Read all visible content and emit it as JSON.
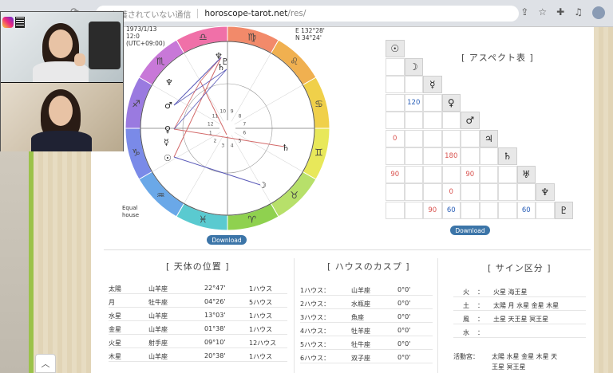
{
  "browser": {
    "warn_icon": "warning-icon",
    "warn_text": "保護されていない通信",
    "url_host": "horoscope-tarot.net",
    "url_path": "/res/"
  },
  "chart": {
    "date": "1973/1/13",
    "time": "12:0",
    "tz": "(UTC+09:00)",
    "lon": "E 132°28'",
    "lat": "N 34°24'",
    "house_system_1": "Equal",
    "house_system_2": "house",
    "download_label": "Download",
    "house_numbers": [
      "1",
      "2",
      "3",
      "4",
      "5",
      "6",
      "7",
      "8",
      "9",
      "10",
      "11",
      "12"
    ]
  },
  "aspect": {
    "title": "[ アスペクト表 ]",
    "download_label": "Download",
    "planets": [
      "☉",
      "☽",
      "☿",
      "♀",
      "♂",
      "♃",
      "♄",
      "♅",
      "♆",
      "♇"
    ],
    "values": [
      {
        "row": 3,
        "col": 1,
        "text": "120",
        "color": "blue"
      },
      {
        "row": 5,
        "col": 0,
        "text": "0",
        "color": "red"
      },
      {
        "row": 6,
        "col": 3,
        "text": "180",
        "color": "red"
      },
      {
        "row": 7,
        "col": 0,
        "text": "90",
        "color": "red"
      },
      {
        "row": 7,
        "col": 4,
        "text": "90",
        "color": "red"
      },
      {
        "row": 8,
        "col": 3,
        "text": "0",
        "color": "red"
      },
      {
        "row": 9,
        "col": 2,
        "text": "90",
        "color": "red"
      },
      {
        "row": 9,
        "col": 3,
        "text": "60",
        "color": "blue"
      },
      {
        "row": 9,
        "col": 7,
        "text": "60",
        "color": "blue"
      }
    ]
  },
  "planets_table": {
    "title": "[ 天体の位置 ]",
    "rows": [
      {
        "planet": "太陽",
        "sign": "山羊座",
        "deg": "22°47'",
        "house": "1ハウス"
      },
      {
        "planet": "月",
        "sign": "牡牛座",
        "deg": "04°26'",
        "house": "5ハウス"
      },
      {
        "planet": "水星",
        "sign": "山羊座",
        "deg": "13°03'",
        "house": "1ハウス"
      },
      {
        "planet": "金星",
        "sign": "山羊座",
        "deg": "01°38'",
        "house": "1ハウス"
      },
      {
        "planet": "火星",
        "sign": "射手座",
        "deg": "09°10'",
        "house": "12ハウス"
      },
      {
        "planet": "木星",
        "sign": "山羊座",
        "deg": "20°38'",
        "house": "1ハウス"
      }
    ]
  },
  "cusps_table": {
    "title": "[ ハウスのカスプ ]",
    "rows": [
      {
        "house": "1ハウス：",
        "sign": "山羊座",
        "deg": "0°0'"
      },
      {
        "house": "2ハウス：",
        "sign": "水瓶座",
        "deg": "0°0'"
      },
      {
        "house": "3ハウス：",
        "sign": "魚座",
        "deg": "0°0'"
      },
      {
        "house": "4ハウス：",
        "sign": "牡羊座",
        "deg": "0°0'"
      },
      {
        "house": "5ハウス：",
        "sign": "牡牛座",
        "deg": "0°0'"
      },
      {
        "house": "6ハウス：",
        "sign": "双子座",
        "deg": "0°0'"
      }
    ]
  },
  "sign_table": {
    "title": "[ サイン区分 ]",
    "rows": [
      {
        "label": "火",
        "colon": "：",
        "value": "火星 海王星"
      },
      {
        "label": "土",
        "colon": "：",
        "value": "太陽 月 水星 金星 木星"
      },
      {
        "label": "風",
        "colon": "：",
        "value": "土星 天王星 冥王星"
      },
      {
        "label": "水",
        "colon": "：",
        "value": ""
      }
    ],
    "active_label": "活動宮：",
    "active_line1": "太陽 水星 金星 木星 天",
    "active_line2": "王星 冥王星"
  }
}
